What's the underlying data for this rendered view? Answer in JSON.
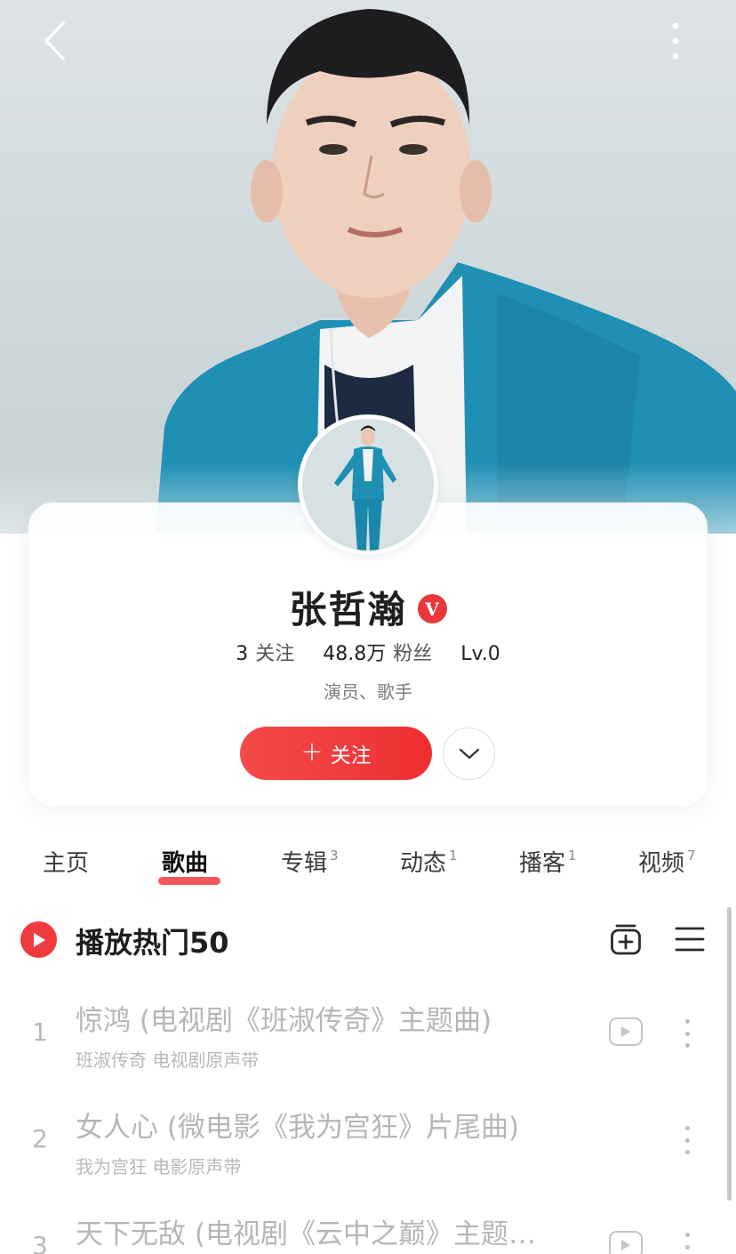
{
  "profile": {
    "name": "张哲瀚",
    "verified_badge": "V",
    "following_count": "3",
    "following_label": "关注",
    "fans_count": "48.8万",
    "fans_label": "粉丝",
    "level": "Lv.0",
    "identity": "演员、歌手",
    "follow_button": "关注",
    "follow_plus": "+"
  },
  "tabs": [
    {
      "label": "主页",
      "count": ""
    },
    {
      "label": "歌曲",
      "count": ""
    },
    {
      "label": "专辑",
      "count": "3"
    },
    {
      "label": "动态",
      "count": "1"
    },
    {
      "label": "播客",
      "count": "1"
    },
    {
      "label": "视频",
      "count": "7"
    }
  ],
  "active_tab": "歌曲",
  "hot_songs": {
    "title": "播放热门50",
    "songs": [
      {
        "index": "1",
        "title": "惊鸿 (电视剧《班淑传奇》主题曲)",
        "subtitle": "班淑传奇 电视剧原声带",
        "has_mv": true
      },
      {
        "index": "2",
        "title": "女人心 (微电影《我为宫狂》片尾曲)",
        "subtitle": "我为宫狂 电影原声带",
        "has_mv": false
      },
      {
        "index": "3",
        "title": "天下无敌 (电视剧《云中之巅》主题…",
        "subtitle": "",
        "has_mv": true
      }
    ]
  },
  "colors": {
    "accent": "#ef3b3e",
    "jacket": "#1e8fb3"
  },
  "icons": {
    "back": "chevron-left-icon",
    "more": "vertical-dots-icon",
    "expand": "chevron-down-icon",
    "play": "play-icon",
    "add_playlist": "add-to-playlist-icon",
    "list": "list-menu-icon",
    "mv": "video-play-icon"
  }
}
